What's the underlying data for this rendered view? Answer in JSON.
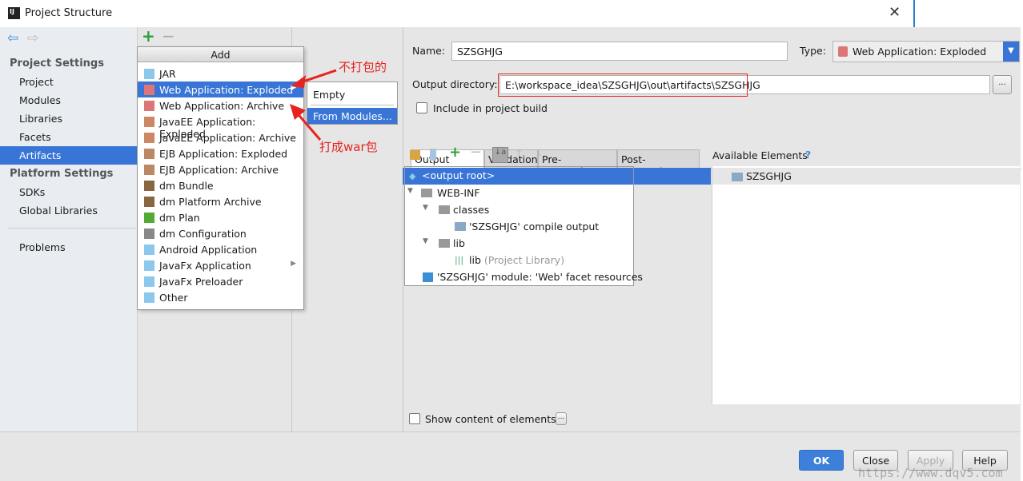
{
  "window": {
    "title": "Project Structure",
    "logo": "IJ",
    "close": "✕"
  },
  "sidebar": {
    "back": "⇦",
    "forward": "⇨",
    "project_settings": "Project Settings",
    "items": [
      "Project",
      "Modules",
      "Libraries",
      "Facets",
      "Artifacts"
    ],
    "platform_settings": "Platform Settings",
    "platform_items": [
      "SDKs",
      "Global Libraries"
    ],
    "problems": "Problems"
  },
  "mid": {
    "add": "+",
    "remove": "−"
  },
  "menu": {
    "header": "Add",
    "items": [
      {
        "label": "JAR",
        "icon": "jar-icon"
      },
      {
        "label": "Web Application: Exploded",
        "icon": "web-app-icon",
        "submenu": true
      },
      {
        "label": "Web Application: Archive",
        "icon": "web-app-icon"
      },
      {
        "label": "JavaEE Application: Exploded",
        "icon": "javaee-icon"
      },
      {
        "label": "JavaEE Application: Archive",
        "icon": "javaee-icon"
      },
      {
        "label": "EJB Application: Exploded",
        "icon": "ejb-icon"
      },
      {
        "label": "EJB Application: Archive",
        "icon": "ejb-icon"
      },
      {
        "label": "dm Bundle",
        "icon": "dm-bundle-icon"
      },
      {
        "label": "dm Platform Archive",
        "icon": "dm-platform-icon"
      },
      {
        "label": "dm Plan",
        "icon": "dm-plan-icon"
      },
      {
        "label": "dm Configuration",
        "icon": "dm-config-icon"
      },
      {
        "label": "Android Application",
        "icon": "android-icon"
      },
      {
        "label": "JavaFx Application",
        "icon": "javafx-icon",
        "submenu": true
      },
      {
        "label": "JavaFx Preloader",
        "icon": "javafx-icon"
      },
      {
        "label": "Other",
        "icon": "other-icon"
      }
    ],
    "submenu": [
      "Empty",
      "From Modules..."
    ]
  },
  "annotations": {
    "exploded": "不打包的",
    "archive": "打成war包"
  },
  "form": {
    "name_label": "Name:",
    "name_value": "SZSGHJG",
    "type_label": "Type:",
    "type_value": "Web Application: Exploded",
    "output_label": "Output directory:",
    "output_value": "E:\\workspace_idea\\SZSGHJG\\out\\artifacts\\SZSGHJG",
    "browse": "...",
    "include_label": "Include in project build"
  },
  "tabs": [
    "Output Layout",
    "Validation",
    "Pre-processing",
    "Post-processing"
  ],
  "tree": [
    {
      "label": "<output root>",
      "level": 0,
      "selected": true
    },
    {
      "label": "WEB-INF",
      "level": 0
    },
    {
      "label": "classes",
      "level": 1
    },
    {
      "label": "'SZSGHJG' compile output",
      "level": 2
    },
    {
      "label": "lib",
      "level": 1
    },
    {
      "label": "lib",
      "suffix": "(Project Library)",
      "level": 2
    },
    {
      "label": "'SZSGHJG' module: 'Web' facet resources",
      "level": 0
    }
  ],
  "available": {
    "label": "Available Elements",
    "help": "?",
    "items": [
      "SZSGHJG"
    ]
  },
  "show_content": "Show content of elements",
  "buttons": {
    "ok": "OK",
    "close": "Close",
    "apply": "Apply",
    "help": "Help"
  },
  "watermark": "https://www.dqv5.com",
  "colors": {
    "accent": "#3875d7",
    "annotation": "#e8231f"
  }
}
